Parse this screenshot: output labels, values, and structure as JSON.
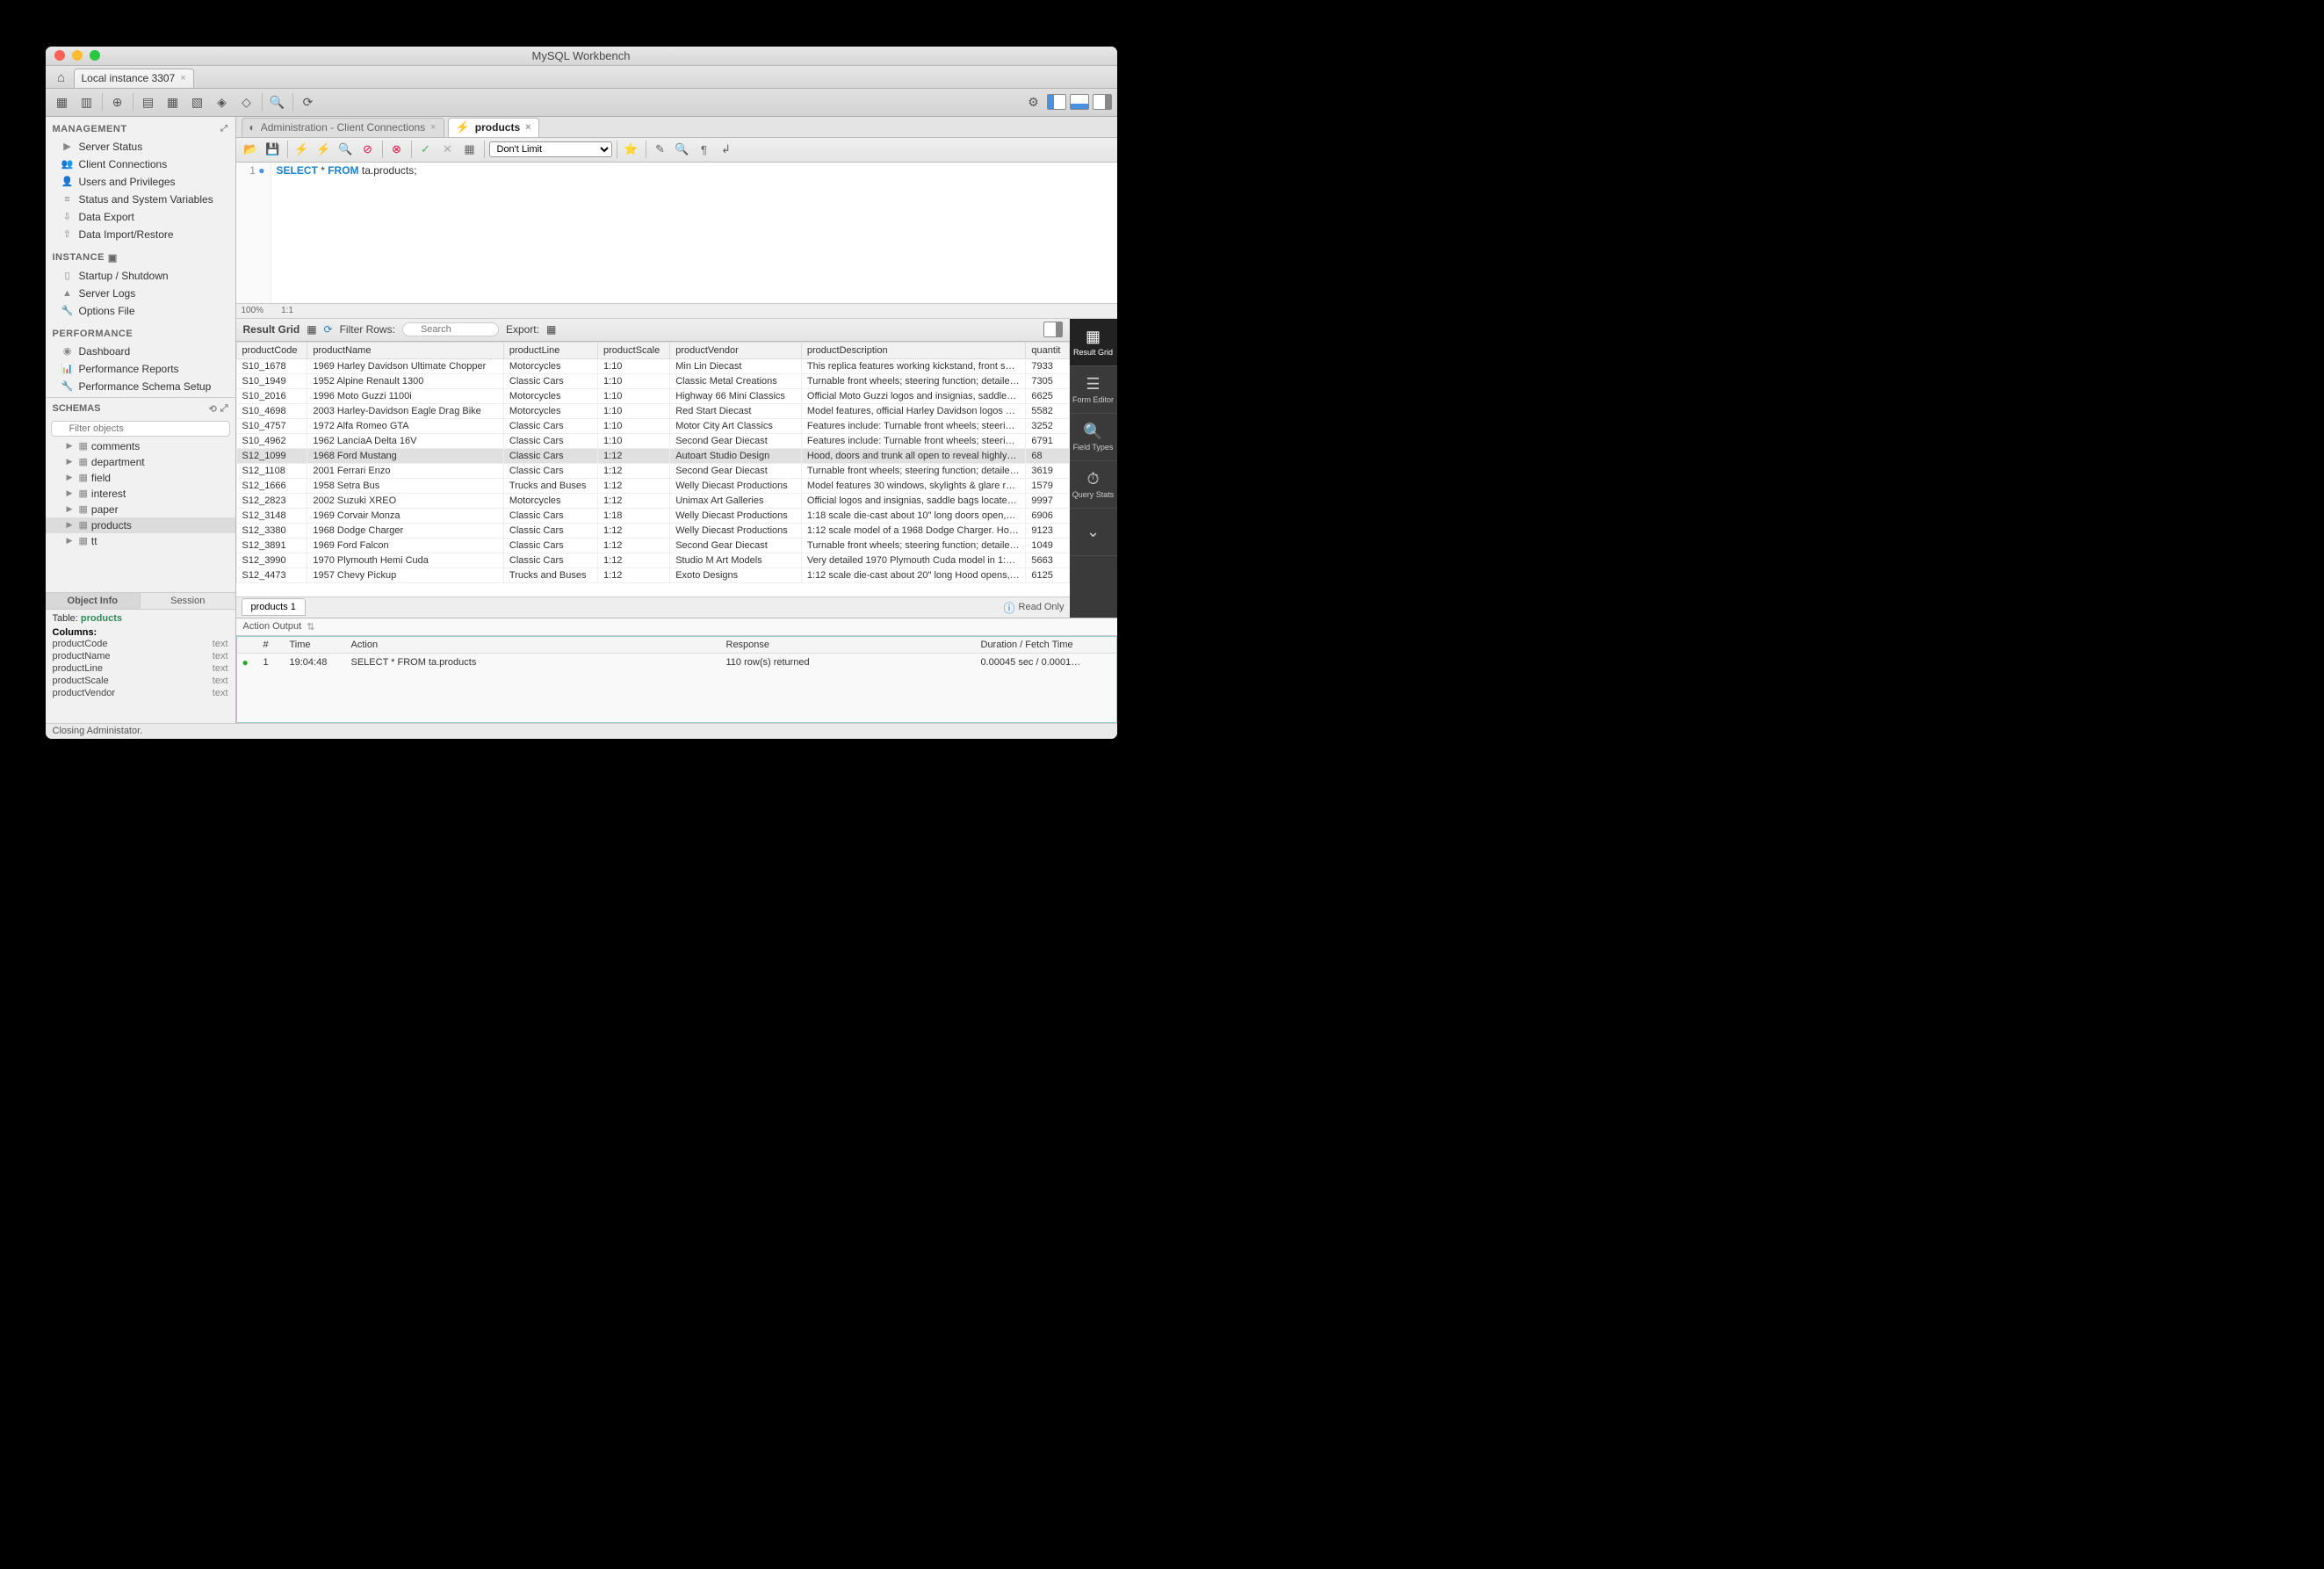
{
  "title": "MySQL Workbench",
  "conn_tab": "Local instance 3307",
  "sidebar": {
    "management": {
      "hdr": "MANAGEMENT",
      "items": [
        "Server Status",
        "Client Connections",
        "Users and Privileges",
        "Status and System Variables",
        "Data Export",
        "Data Import/Restore"
      ]
    },
    "instance": {
      "hdr": "INSTANCE",
      "items": [
        "Startup / Shutdown",
        "Server Logs",
        "Options File"
      ]
    },
    "performance": {
      "hdr": "PERFORMANCE",
      "items": [
        "Dashboard",
        "Performance Reports",
        "Performance Schema Setup"
      ]
    },
    "schemas_hdr": "SCHEMAS",
    "filter_placeholder": "Filter objects",
    "tree": [
      "comments",
      "department",
      "field",
      "interest",
      "paper",
      "products",
      "tt"
    ],
    "tab_objinfo": "Object Info",
    "tab_session": "Session",
    "table_label": "Table:",
    "table_name": "products",
    "columns_label": "Columns:",
    "columns": [
      {
        "n": "productCode",
        "t": "text"
      },
      {
        "n": "productName",
        "t": "text"
      },
      {
        "n": "productLine",
        "t": "text"
      },
      {
        "n": "productScale",
        "t": "text"
      },
      {
        "n": "productVendor",
        "t": "text"
      }
    ]
  },
  "editor_tabs": {
    "admin": "Administration - Client Connections",
    "products": "products"
  },
  "limit_label": "Don't Limit",
  "sql_line": "1",
  "sql": {
    "kw1": "SELECT",
    "star": "*",
    "kw2": "FROM",
    "rest": "ta.products;"
  },
  "zoom": "100%",
  "pos": "1:1",
  "result": {
    "hdr": "Result Grid",
    "filter_lbl": "Filter Rows:",
    "search_placeholder": "Search",
    "export_lbl": "Export:",
    "readonly": "Read Only",
    "tab": "products 1",
    "cols": [
      "productCode",
      "productName",
      "productLine",
      "productScale",
      "productVendor",
      "productDescription",
      "quantit"
    ],
    "rows": [
      [
        "S10_1678",
        "1969 Harley Davidson Ultimate Chopper",
        "Motorcycles",
        "1:10",
        "Min Lin Diecast",
        "This replica features working kickstand, front su…",
        "7933"
      ],
      [
        "S10_1949",
        "1952 Alpine Renault 1300",
        "Classic Cars",
        "1:10",
        "Classic Metal Creations",
        "Turnable front wheels; steering function; detaile…",
        "7305"
      ],
      [
        "S10_2016",
        "1996 Moto Guzzi 1100i",
        "Motorcycles",
        "1:10",
        "Highway 66 Mini Classics",
        "Official Moto Guzzi logos and insignias, saddle…",
        "6625"
      ],
      [
        "S10_4698",
        "2003 Harley-Davidson Eagle Drag Bike",
        "Motorcycles",
        "1:10",
        "Red Start Diecast",
        "Model features, official Harley Davidson logos a…",
        "5582"
      ],
      [
        "S10_4757",
        "1972 Alfa Romeo GTA",
        "Classic Cars",
        "1:10",
        "Motor City Art Classics",
        "Features include: Turnable front wheels; steerin…",
        "3252"
      ],
      [
        "S10_4962",
        "1962 LanciaA Delta 16V",
        "Classic Cars",
        "1:10",
        "Second Gear Diecast",
        "Features include: Turnable front wheels; steerin…",
        "6791"
      ],
      [
        "S12_1099",
        "1968 Ford Mustang",
        "Classic Cars",
        "1:12",
        "Autoart Studio Design",
        "Hood, doors and trunk all open to reveal highly…",
        "68"
      ],
      [
        "S12_1108",
        "2001 Ferrari Enzo",
        "Classic Cars",
        "1:12",
        "Second Gear Diecast",
        "Turnable front wheels; steering function; detaile…",
        "3619"
      ],
      [
        "S12_1666",
        "1958 Setra Bus",
        "Trucks and Buses",
        "1:12",
        "Welly Diecast Productions",
        "Model features 30 windows, skylights & glare re…",
        "1579"
      ],
      [
        "S12_2823",
        "2002 Suzuki XREO",
        "Motorcycles",
        "1:12",
        "Unimax Art Galleries",
        "Official logos and insignias, saddle bags located…",
        "9997"
      ],
      [
        "S12_3148",
        "1969 Corvair Monza",
        "Classic Cars",
        "1:18",
        "Welly Diecast Productions",
        "1:18 scale die-cast about 10\" long doors open,…",
        "6906"
      ],
      [
        "S12_3380",
        "1968 Dodge Charger",
        "Classic Cars",
        "1:12",
        "Welly Diecast Productions",
        "1:12 scale model of a 1968 Dodge Charger. Ho…",
        "9123"
      ],
      [
        "S12_3891",
        "1969 Ford Falcon",
        "Classic Cars",
        "1:12",
        "Second Gear Diecast",
        "Turnable front wheels; steering function; detaile…",
        "1049"
      ],
      [
        "S12_3990",
        "1970 Plymouth Hemi Cuda",
        "Classic Cars",
        "1:12",
        "Studio M Art Models",
        "Very detailed 1970 Plymouth Cuda model in 1:1…",
        "5663"
      ],
      [
        "S12_4473",
        "1957 Chevy Pickup",
        "Trucks and Buses",
        "1:12",
        "Exoto Designs",
        "1:12 scale die-cast about 20\" long Hood opens,…",
        "6125"
      ]
    ],
    "selected_row": 6
  },
  "tools": [
    "Result Grid",
    "Form Editor",
    "Field Types",
    "Query Stats"
  ],
  "action": {
    "hdr": "Action Output",
    "cols": [
      "",
      "#",
      "Time",
      "Action",
      "Response",
      "Duration / Fetch Time"
    ],
    "row": {
      "n": "1",
      "time": "19:04:48",
      "action": "SELECT * FROM ta.products",
      "response": "110 row(s) returned",
      "dur": "0.00045 sec / 0.0001…"
    }
  },
  "status": "Closing Administator."
}
